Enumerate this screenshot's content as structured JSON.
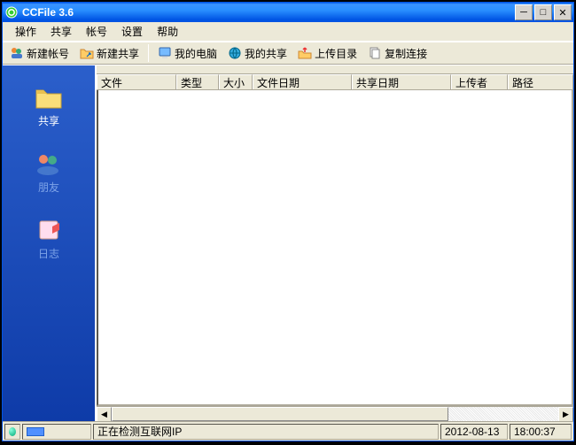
{
  "title": "CCFile 3.6",
  "menus": [
    "操作",
    "共享",
    "帐号",
    "设置",
    "帮助"
  ],
  "toolbar": {
    "new_account": "新建帐号",
    "new_share": "新建共享",
    "my_computer": "我的电脑",
    "my_share": "我的共享",
    "upload_dir": "上传目录",
    "copy_link": "复制连接"
  },
  "sidebar": {
    "share": "共享",
    "friends": "朋友",
    "logs": "日志"
  },
  "columns": {
    "file": "文件",
    "type": "类型",
    "size": "大小",
    "file_date": "文件日期",
    "share_date": "共享日期",
    "uploader": "上传者",
    "path": "路径"
  },
  "status": {
    "message": "正在检测互联网IP",
    "date": "2012-08-13",
    "time": "18:00:37"
  }
}
